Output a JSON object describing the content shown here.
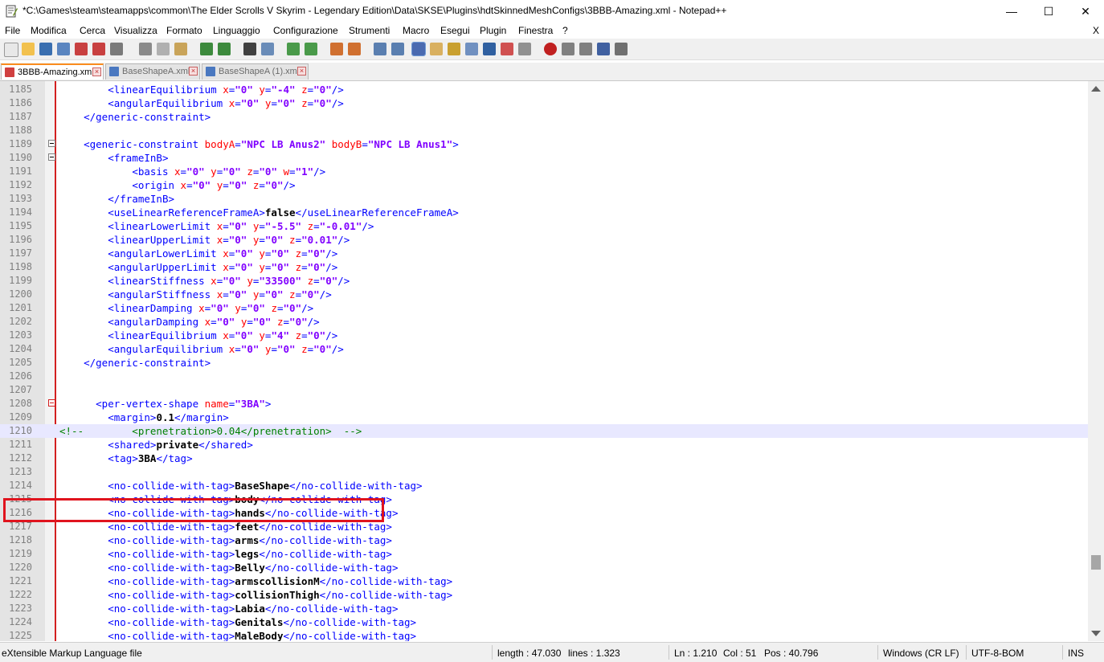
{
  "window": {
    "title": "*C:\\Games\\steam\\steamapps\\common\\The Elder Scrolls V Skyrim - Legendary Edition\\Data\\SKSE\\Plugins\\hdtSkinnedMeshConfigs\\3BBB-Amazing.xml - Notepad++",
    "minimize": "—",
    "maximize": "☐",
    "close": "✕"
  },
  "menu": {
    "items": [
      "File",
      "Modifica",
      "Cerca",
      "Visualizza",
      "Formato",
      "Linguaggio",
      "Configurazione",
      "Strumenti",
      "Macro",
      "Esegui",
      "Plugin",
      "Finestra",
      "?"
    ],
    "close": "X"
  },
  "tabs": [
    {
      "label": "3BBB-Amazing.xml",
      "active": true
    },
    {
      "label": "BaseShapeA.xml",
      "active": false
    },
    {
      "label": "BaseShapeA (1).xml",
      "active": false
    }
  ],
  "editor": {
    "current_line": "1210",
    "lines": [
      {
        "n": "1185",
        "t": "        <linearEquilibrium x=\"0\" y=\"-4\" z=\"0\"/>"
      },
      {
        "n": "1186",
        "t": "        <angularEquilibrium x=\"0\" y=\"0\" z=\"0\"/>"
      },
      {
        "n": "1187",
        "t": "    </generic-constraint>"
      },
      {
        "n": "1188",
        "t": ""
      },
      {
        "n": "1189",
        "t": "    <generic-constraint bodyA=\"NPC LB Anus2\" bodyB=\"NPC LB Anus1\">"
      },
      {
        "n": "1190",
        "t": "        <frameInB>"
      },
      {
        "n": "1191",
        "t": "            <basis x=\"0\" y=\"0\" z=\"0\" w=\"1\"/>"
      },
      {
        "n": "1192",
        "t": "            <origin x=\"0\" y=\"0\" z=\"0\"/>"
      },
      {
        "n": "1193",
        "t": "        </frameInB>"
      },
      {
        "n": "1194",
        "t": "        <useLinearReferenceFrameA>false</useLinearReferenceFrameA>"
      },
      {
        "n": "1195",
        "t": "        <linearLowerLimit x=\"0\" y=\"-5.5\" z=\"-0.01\"/>"
      },
      {
        "n": "1196",
        "t": "        <linearUpperLimit x=\"0\" y=\"0\" z=\"0.01\"/>"
      },
      {
        "n": "1197",
        "t": "        <angularLowerLimit x=\"0\" y=\"0\" z=\"0\"/>"
      },
      {
        "n": "1198",
        "t": "        <angularUpperLimit x=\"0\" y=\"0\" z=\"0\"/>"
      },
      {
        "n": "1199",
        "t": "        <linearStiffness x=\"0\" y=\"33500\" z=\"0\"/>"
      },
      {
        "n": "1200",
        "t": "        <angularStiffness x=\"0\" y=\"0\" z=\"0\"/>"
      },
      {
        "n": "1201",
        "t": "        <linearDamping x=\"0\" y=\"0\" z=\"0\"/>"
      },
      {
        "n": "1202",
        "t": "        <angularDamping x=\"0\" y=\"0\" z=\"0\"/>"
      },
      {
        "n": "1203",
        "t": "        <linearEquilibrium x=\"0\" y=\"4\" z=\"0\"/>"
      },
      {
        "n": "1204",
        "t": "        <angularEquilibrium x=\"0\" y=\"0\" z=\"0\"/>"
      },
      {
        "n": "1205",
        "t": "    </generic-constraint>"
      },
      {
        "n": "1206",
        "t": ""
      },
      {
        "n": "1207",
        "t": ""
      },
      {
        "n": "1208",
        "t": "      <per-vertex-shape name=\"3BA\">"
      },
      {
        "n": "1209",
        "t": "        <margin>0.1</margin>"
      },
      {
        "n": "1210",
        "t": "<!--        <prenetration>0.04</prenetration>  -->"
      },
      {
        "n": "1211",
        "t": "        <shared>private</shared>"
      },
      {
        "n": "1212",
        "t": "        <tag>3BA</tag>"
      },
      {
        "n": "1213",
        "t": ""
      },
      {
        "n": "1214",
        "t": "        <no-collide-with-tag>BaseShape</no-collide-with-tag>"
      },
      {
        "n": "1215",
        "t": "        <no-collide-with-tag>body</no-collide-with-tag>"
      },
      {
        "n": "1216",
        "t": "        <no-collide-with-tag>hands</no-collide-with-tag>"
      },
      {
        "n": "1217",
        "t": "        <no-collide-with-tag>feet</no-collide-with-tag>"
      },
      {
        "n": "1218",
        "t": "        <no-collide-with-tag>arms</no-collide-with-tag>"
      },
      {
        "n": "1219",
        "t": "        <no-collide-with-tag>legs</no-collide-with-tag>"
      },
      {
        "n": "1220",
        "t": "        <no-collide-with-tag>Belly</no-collide-with-tag>"
      },
      {
        "n": "1221",
        "t": "        <no-collide-with-tag>armscollisionM</no-collide-with-tag>"
      },
      {
        "n": "1222",
        "t": "        <no-collide-with-tag>collisionThigh</no-collide-with-tag>"
      },
      {
        "n": "1223",
        "t": "        <no-collide-with-tag>Labia</no-collide-with-tag>"
      },
      {
        "n": "1224",
        "t": "        <no-collide-with-tag>Genitals</no-collide-with-tag>"
      },
      {
        "n": "1225",
        "t": "        <no-collide-with-tag>MaleBody</no-collide-with-tag>"
      }
    ]
  },
  "status": {
    "filetype": "eXtensible Markup Language file",
    "length": "length : 47.030",
    "lines": "lines : 1.323",
    "ln": "Ln : 1.210",
    "col": "Col : 51",
    "pos": "Pos : 40.796",
    "eol": "Windows (CR LF)",
    "encoding": "UTF-8-BOM",
    "mode": "INS"
  },
  "colors": {
    "tag": "#0000ff",
    "attribute": "#ff0000",
    "value": "#8000ff",
    "comment": "#008000",
    "highlight_box": "#e0141e",
    "current_line": "#e8e8ff"
  }
}
